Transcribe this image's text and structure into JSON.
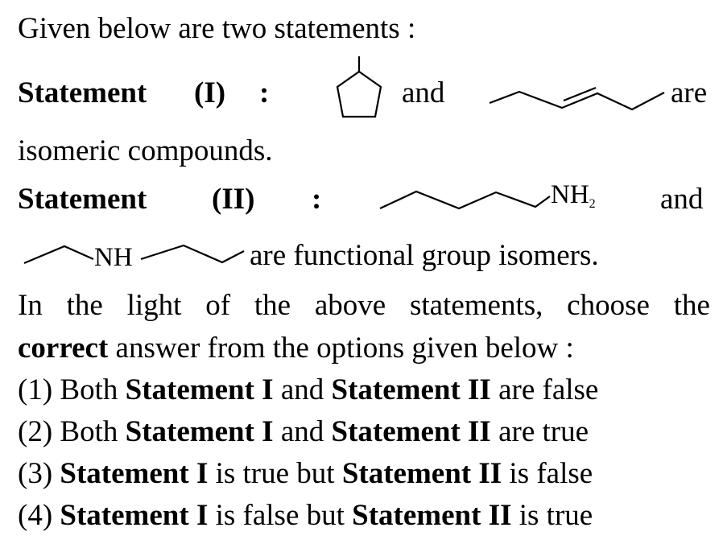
{
  "question": {
    "intro": "Given below are two statements :",
    "statement1": {
      "word": "Statement",
      "num": "(I)",
      "colon": ":",
      "and": "and",
      "are": "are",
      "continuation": "isomeric compounds."
    },
    "statement2": {
      "word": "Statement",
      "num": "(II)",
      "colon": ":",
      "and": "and",
      "amine_label": "NH",
      "amine_sub": "2",
      "secondary_label": "NH",
      "continuation": "are functional group isomers."
    },
    "prompt_line1": [
      "In",
      "the",
      "light",
      "of",
      "the",
      "above",
      "statements,",
      "choose",
      "the"
    ],
    "prompt_line2_bold": "correct",
    "prompt_line2_rest": " answer from the options given below :"
  },
  "options": [
    {
      "num": "(1)",
      "pre": " Both ",
      "s1": "Statement I",
      "mid": " and ",
      "s2": "Statement II",
      "post": " are false"
    },
    {
      "num": "(2)",
      "pre": " Both ",
      "s1": "Statement I",
      "mid": " and ",
      "s2": "Statement II",
      "post": " are true"
    },
    {
      "num": "(3) ",
      "pre": "",
      "s1": "Statement I",
      "mid": " is true but ",
      "s2": "Statement II",
      "post": " is false"
    },
    {
      "num": "(4) ",
      "pre": "",
      "s1": "Statement I",
      "mid": " is false but ",
      "s2": "Statement II",
      "post": " is true"
    }
  ]
}
